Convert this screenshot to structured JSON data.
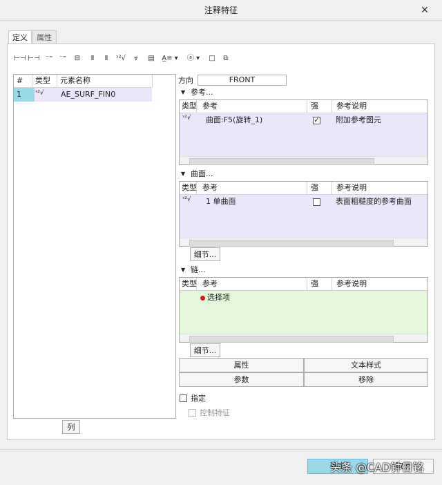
{
  "window": {
    "title": "注释特征",
    "close_glyph": "✕"
  },
  "tabs": [
    {
      "label": "定义"
    },
    {
      "label": "属性"
    }
  ],
  "toolbar": {
    "icons": [
      "⊢⊣",
      "⊢⊣",
      "⁻⁼",
      "⁻⁼",
      "⊟",
      "Ⅱ",
      "ᵌ²√",
      "⩔",
      "▤",
      "A̲≡ ▾",
      "ⓐ ▾",
      "□",
      "⧉"
    ]
  },
  "elements_table": {
    "headers": [
      "#",
      "类型",
      "元素名称"
    ],
    "rows": [
      {
        "num": "1",
        "type_glyph": "ᵌ²√",
        "name": "AE_SURF_FIN0"
      }
    ]
  },
  "column_button": "列",
  "direction": {
    "label": "方向",
    "value": "FRONT"
  },
  "references": {
    "label": "参考...",
    "headers": [
      "类型",
      "参考",
      "强",
      "参考说明"
    ],
    "rows": [
      {
        "type_glyph": "ᵌ²√",
        "ref": "曲面:F5(旋转_1)",
        "strong": "✓",
        "desc": "附加参考图元"
      }
    ]
  },
  "surfaces": {
    "label": "曲面...",
    "headers": [
      "类型",
      "参考",
      "强",
      "参考说明"
    ],
    "rows": [
      {
        "type_glyph": "ᵌ²√",
        "ref": "1 单曲面",
        "strong": "",
        "desc": "表面粗糙度的参考曲面"
      }
    ],
    "details_button": "细节..."
  },
  "chains": {
    "label": "链...",
    "headers": [
      "类型",
      "参考",
      "强",
      "参考说明"
    ],
    "placeholder": "选择项",
    "details_button": "细节..."
  },
  "action_buttons": {
    "properties": "属性",
    "text_style": "文本样式",
    "parameters": "参数",
    "remove": "移除"
  },
  "options": {
    "specify": "指定",
    "control_feature": "控制特征"
  },
  "footer": {
    "ok_label": "确定",
    "cancel_label": "取消",
    "watermark": "头条 @CAD钟日铭"
  },
  "colors": {
    "accent": "#99d9ea",
    "selected_row": "#ece6fa",
    "chain_bg": "#e4f7da",
    "bullet": "#cc2222"
  }
}
